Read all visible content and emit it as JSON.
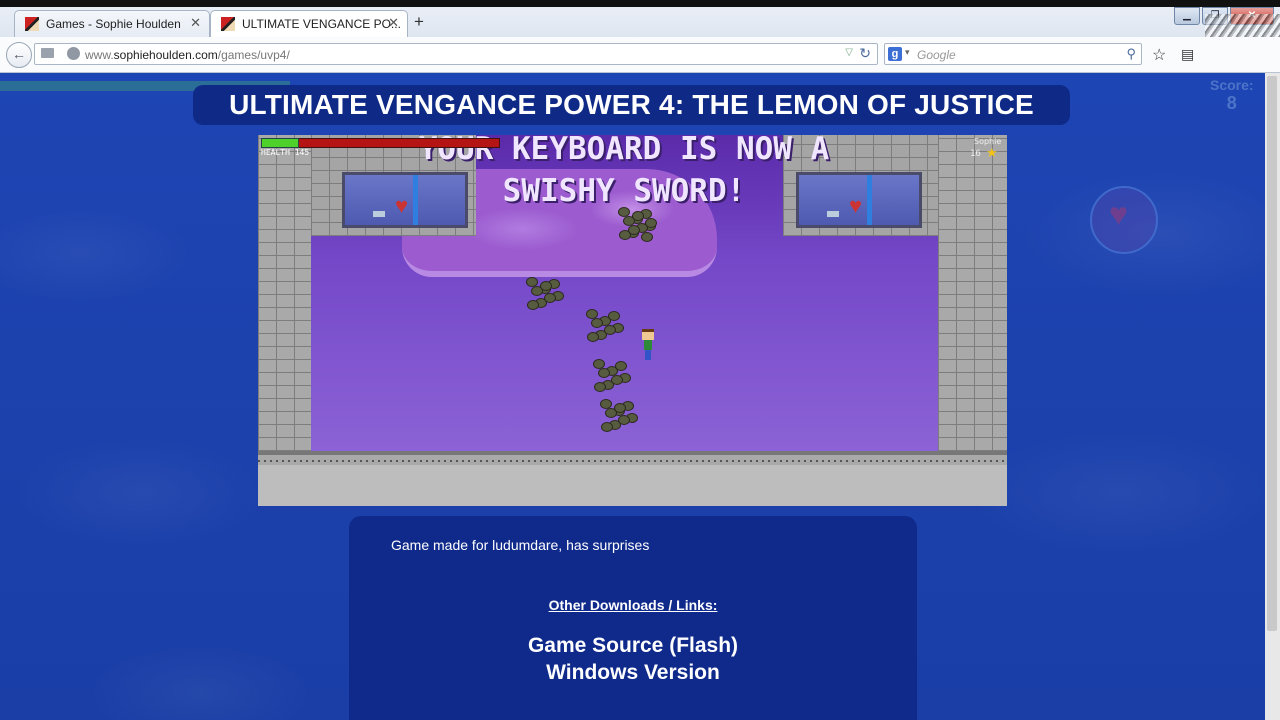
{
  "browser": {
    "tabs": [
      {
        "title": "Games - Sophie Houlden",
        "active": false
      },
      {
        "title": "ULTIMATE VENGANCE PO...",
        "active": true
      }
    ],
    "new_tab": "+",
    "close_glyph": "✕",
    "url_prefix": "www.",
    "url_domain": "sophiehoulden.com",
    "url_path": "/games/uvp4/",
    "search_engine": "g",
    "search_placeholder": "Google"
  },
  "page": {
    "title": "ULTIMATE VENGANCE POWER 4: THE LEMON OF JUSTICE",
    "background_hud": {
      "score_label": "Score:",
      "score_value": "8"
    }
  },
  "game": {
    "message_line1": "YOUR KEYBOARD IS NOW A",
    "message_line2": "SWISHY SWORD!",
    "health_label": "HEALTH",
    "health_value": "145",
    "health_fraction": 0.15,
    "player_name": "Sophie",
    "player_score": "16"
  },
  "info": {
    "description": "Game made for ludumdare, has surprises",
    "downloads_heading": "Other Downloads / Links:",
    "links": [
      "Game Source (Flash)",
      "Windows Version"
    ]
  },
  "colors": {
    "page_background": "#1a3da3",
    "title_background": "#0e2a86",
    "health_fill": "#4fd12b",
    "health_back": "#b51414"
  }
}
